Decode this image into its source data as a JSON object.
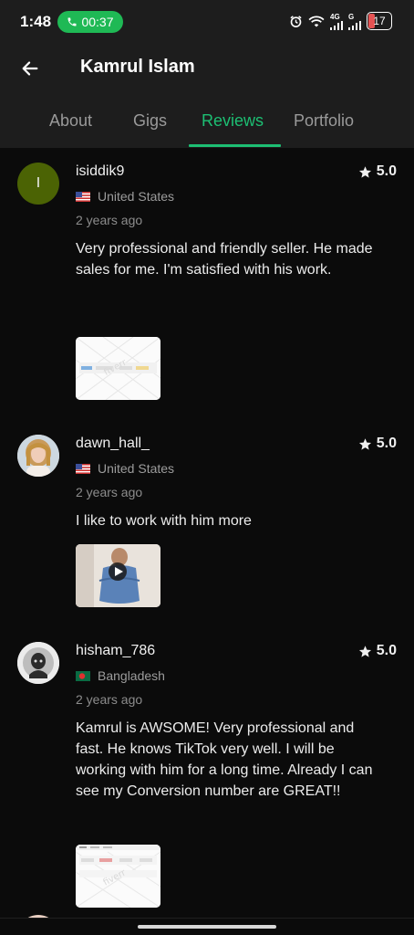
{
  "status_bar": {
    "time": "1:48",
    "call_duration": "00:37",
    "network_label_1": "4G",
    "network_label_2": "G",
    "battery": "17"
  },
  "header": {
    "title": "Kamrul Islam",
    "tabs": [
      {
        "label": "About",
        "active": false
      },
      {
        "label": "Gigs",
        "active": false
      },
      {
        "label": "Reviews",
        "active": true
      },
      {
        "label": "Portfolio",
        "active": false
      }
    ]
  },
  "colors": {
    "accent": "#1dbf73",
    "background": "#0b0b0b",
    "header_bg": "#1d1d1d",
    "call_pill": "#1fb955"
  },
  "reviews": [
    {
      "avatar_letter": "I",
      "username": "isiddik9",
      "rating": "5.0",
      "country": "United States",
      "flag": "us-flag-icon",
      "time_ago": "2 years ago",
      "text": "Very professional and friendly seller. He made sales for me. I'm satisfied with his work.",
      "attachment": "screenshot-thumbnail"
    },
    {
      "avatar_letter": "",
      "username": "dawn_hall_",
      "rating": "5.0",
      "country": "United States",
      "flag": "us-flag-icon",
      "time_ago": "2 years ago",
      "text": "I like to work with him more",
      "attachment": "video-thumbnail"
    },
    {
      "avatar_letter": "",
      "username": "hisham_786",
      "rating": "5.0",
      "country": "Bangladesh",
      "flag": "bd-flag-icon",
      "time_ago": "2 years ago",
      "text": "Kamrul is AWSOME! Very professional and fast. He knows TikTok very well. I will be working with him for a long time. Already I can see my Conversion number are GREAT!!",
      "attachment": "screenshot-thumbnail"
    }
  ]
}
